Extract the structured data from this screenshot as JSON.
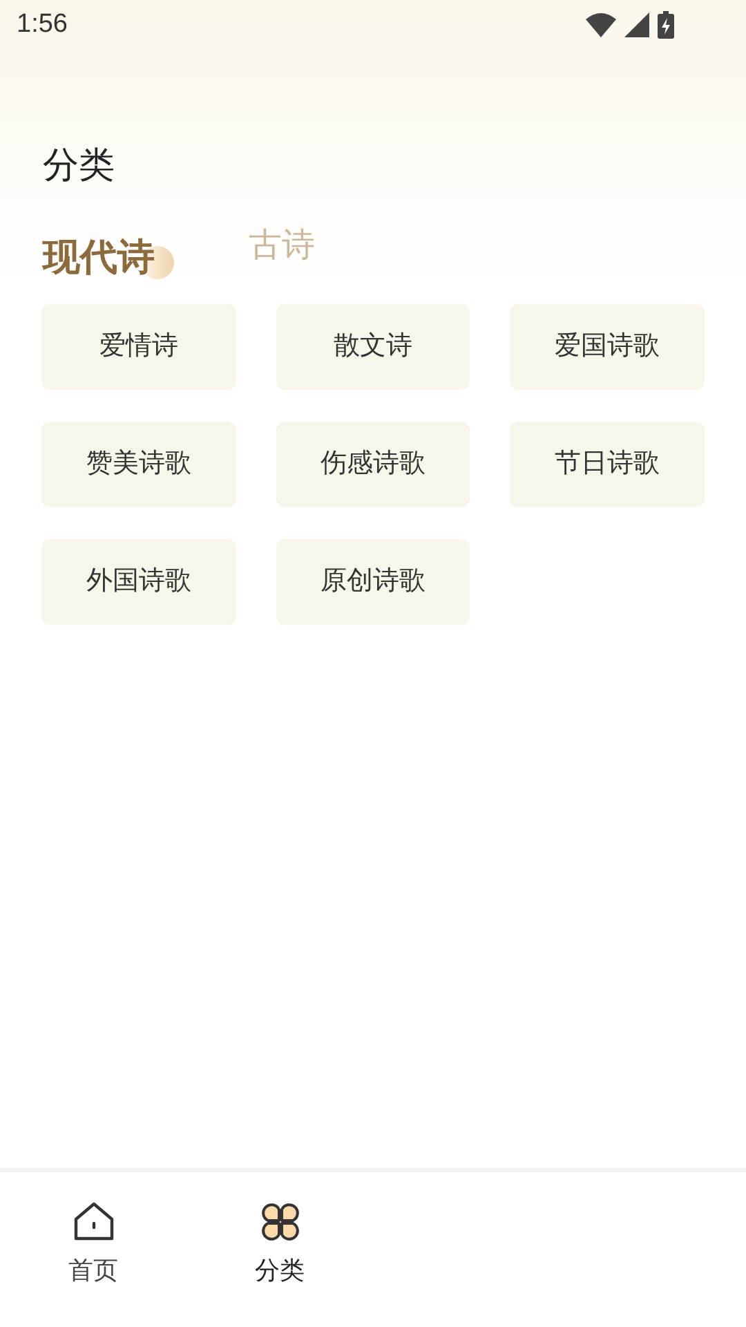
{
  "status_bar": {
    "time": "1:56"
  },
  "page_title": "分类",
  "tabs": [
    {
      "label": "现代诗",
      "selected": true
    },
    {
      "label": "古诗",
      "selected": false
    }
  ],
  "categories": [
    "爱情诗",
    "散文诗",
    "爱国诗歌",
    "赞美诗歌",
    "伤感诗歌",
    "节日诗歌",
    "外国诗歌",
    "原创诗歌"
  ],
  "bottom_nav": [
    {
      "label": "首页",
      "kind": "home",
      "selected": false
    },
    {
      "label": "分类",
      "kind": "category",
      "selected": true
    }
  ]
}
